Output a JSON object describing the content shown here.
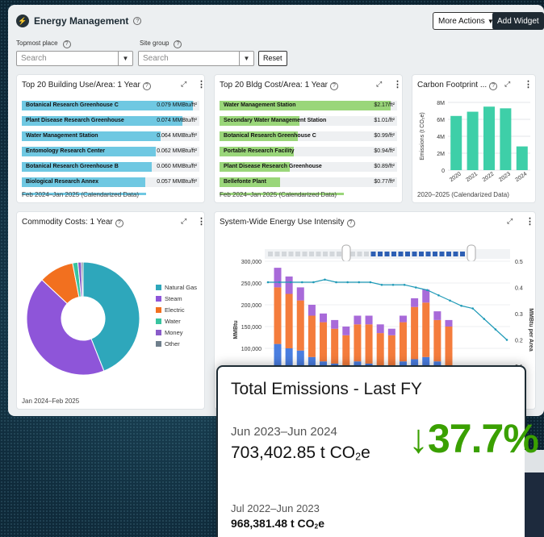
{
  "app": {
    "title": "Energy Management",
    "logo_icon": "energy-logo-icon"
  },
  "toolbar": {
    "more_actions_label": "More Actions",
    "add_widget_label": "Add Widget"
  },
  "filters": {
    "topmost_label": "Topmost place",
    "topmost_placeholder": "Search",
    "site_group_label": "Site group",
    "site_group_placeholder": "Search",
    "reset_label": "Reset"
  },
  "bldg_use": {
    "title": "Top 20 Building Use/Area: 1 Year",
    "footer": "Feb 2024–Jan 2025 (Calendarized Data)",
    "bar_color": "#6fc8e2",
    "max_value": 0.082,
    "rows": [
      {
        "name": "Botanical Research Greenhouse C",
        "value": 0.079,
        "label": "0.079 MMBtu/ft²"
      },
      {
        "name": "Plant Disease Research Greenhouse",
        "value": 0.074,
        "label": "0.074 MMBtu/ft²"
      },
      {
        "name": "Water Management Station",
        "value": 0.064,
        "label": "0.064 MMBtu/ft²"
      },
      {
        "name": "Entomology Research Center",
        "value": 0.062,
        "label": "0.062 MMBtu/ft²"
      },
      {
        "name": "Botanical Research Greenhouse B",
        "value": 0.06,
        "label": "0.060 MMBtu/ft²"
      },
      {
        "name": "Biological Research Annex",
        "value": 0.057,
        "label": "0.057 MMBtu/ft²"
      }
    ]
  },
  "bldg_cost": {
    "title": "Top 20 Bldg Cost/Area: 1 Year",
    "footer": "Feb 2024–Jan 2025 (Calendarized Data)",
    "bar_color": "#9ad67a",
    "max_value": 2.25,
    "rows": [
      {
        "name": "Water Management Station",
        "value": 2.17,
        "label": "$2.17/ft²"
      },
      {
        "name": "Secondary Water Management Station",
        "value": 1.01,
        "label": "$1.01/ft²"
      },
      {
        "name": "Botanical Research Greenhouse C",
        "value": 0.99,
        "label": "$0.99/ft²"
      },
      {
        "name": "Portable Research Facility",
        "value": 0.94,
        "label": "$0.94/ft²"
      },
      {
        "name": "Plant Disease Research Greenhouse",
        "value": 0.89,
        "label": "$0.89/ft²"
      },
      {
        "name": "Bellefonte Plant",
        "value": 0.77,
        "label": "$0.77/ft²"
      }
    ]
  },
  "carbon": {
    "title": "Carbon Footprint ...",
    "footer": "2020–2025 (Calendarized Data)",
    "ylabel": "Emissions (t CO₂e)",
    "color": "#3ecfa8"
  },
  "commodity": {
    "title": "Commodity Costs: 1 Year",
    "footer": "Jan 2024–Feb 2025"
  },
  "eui": {
    "title": "System-Wide Energy Use Intensity",
    "ylabel_left": "MMBtu",
    "ylabel_right": "MMBtu per Area"
  },
  "overlay": {
    "title": "Total Emissions - Last FY",
    "current_period": "Jun 2023–Jun 2024",
    "current_value": "703,402.85 t CO",
    "change_arrow": "↓",
    "change_percent": "37.7%",
    "previous_period": "Jul 2022–Jun 2023",
    "previous_value": "968,381.48 t CO",
    "unit_sub": "2",
    "unit_suffix": "e",
    "accent_color": "#3aa000"
  },
  "chart_data": [
    {
      "type": "bar",
      "title": "Carbon Footprint ...",
      "xlabel": "",
      "ylabel": "Emissions (t CO₂e)",
      "categories": [
        "2020",
        "2021",
        "2022",
        "2023",
        "2024"
      ],
      "values": [
        6400000,
        6900000,
        7500000,
        7300000,
        2800000
      ],
      "yticks": [
        "0",
        "2M",
        "4M",
        "6M",
        "8M"
      ],
      "ylim": [
        0,
        8000000
      ],
      "grid": true
    },
    {
      "type": "pie",
      "title": "Commodity Costs: 1 Year",
      "labels": [
        "Natural Gas",
        "Steam",
        "Electric",
        "Water",
        "Money",
        "Other"
      ],
      "values": [
        44,
        43,
        10,
        1.5,
        1,
        0.5
      ],
      "colors": [
        "#2ea7bb",
        "#8e55d9",
        "#f2701f",
        "#38c49f",
        "#8a5cc9",
        "#6f7f8c"
      ],
      "legend": "right"
    },
    {
      "type": "bar",
      "title": "System-Wide Energy Use Intensity",
      "ylabel": "MMBtu",
      "y2label": "MMBtu per Area",
      "ylim": [
        0,
        300000
      ],
      "y2lim": [
        0,
        0.5
      ],
      "yticks": [
        "100,000",
        "150,000",
        "200,000",
        "250,000",
        "300,000"
      ],
      "y2ticks": [
        "0.1",
        "0.2",
        "0.3",
        "0.4",
        "0.5"
      ],
      "stacked": true,
      "series": [
        {
          "values": [
            110000,
            100000,
            95000,
            80000,
            70000,
            65000,
            60000,
            70000,
            65000,
            60000,
            60000,
            70000,
            75000,
            80000,
            70000,
            60000
          ]
        },
        {
          "values": [
            130000,
            125000,
            115000,
            95000,
            90000,
            80000,
            70000,
            85000,
            90000,
            75000,
            70000,
            90000,
            120000,
            125000,
            95000,
            90000
          ]
        },
        {
          "values": [
            45000,
            40000,
            30000,
            25000,
            20000,
            20000,
            20000,
            20000,
            20000,
            20000,
            15000,
            15000,
            20000,
            30000,
            20000,
            15000
          ]
        }
      ],
      "line": [
        0.42,
        0.42,
        0.42,
        0.42,
        0.42,
        0.43,
        0.42,
        0.42,
        0.42,
        0.42,
        0.41,
        0.41,
        0.41,
        0.4,
        0.39,
        0.37,
        0.35,
        0.33,
        0.32,
        0.28,
        0.24,
        0.2
      ]
    }
  ]
}
